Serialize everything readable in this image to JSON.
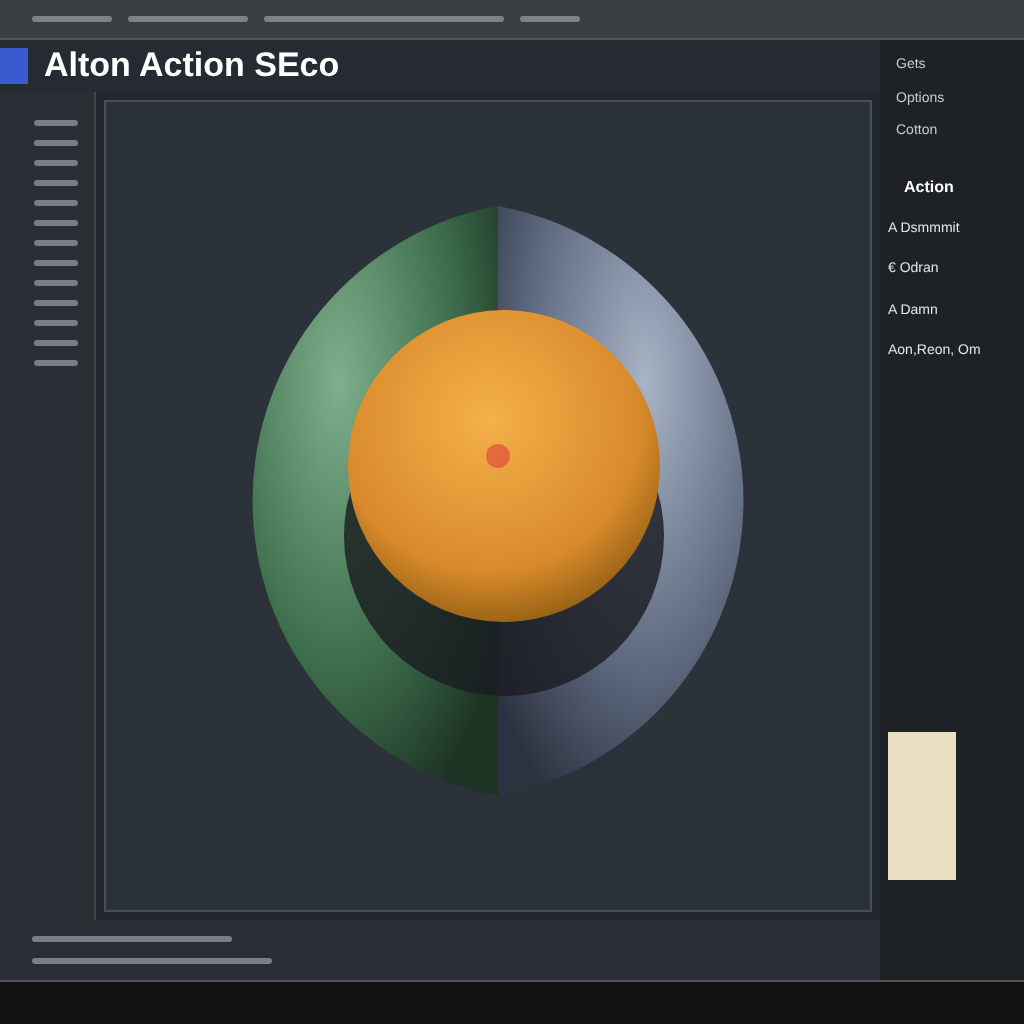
{
  "window": {
    "title": "Alton Action SEco"
  },
  "properties_panel": {
    "fields": [
      "Gets",
      "Options",
      "Cotton"
    ],
    "items": [
      {
        "label": "Action",
        "kind": "heading"
      },
      {
        "label": "A Dsmmmit",
        "kind": "entry"
      },
      {
        "label": "€ Odran",
        "kind": "entry"
      },
      {
        "label": "A Damn",
        "kind": "entry"
      },
      {
        "label": "Aon,Reon, Om",
        "kind": "entry"
      }
    ]
  }
}
